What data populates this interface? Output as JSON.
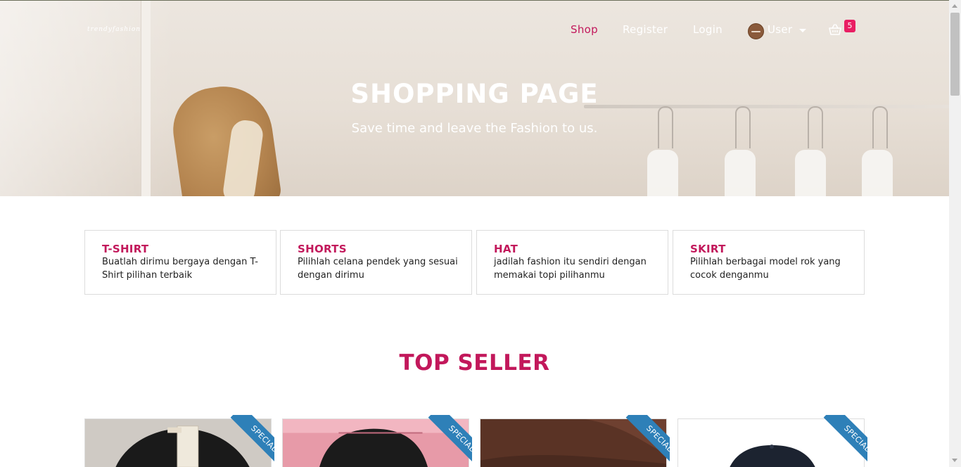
{
  "nav": {
    "logo": "trendyfashion",
    "links": [
      {
        "label": "Shop",
        "active": true
      },
      {
        "label": "Register",
        "active": false
      },
      {
        "label": "Login",
        "active": false
      }
    ],
    "user_label": "User",
    "cart_count": "5"
  },
  "hero": {
    "title": "SHOPPING PAGE",
    "subtitle": "Save time and leave the Fashion to us."
  },
  "categories": [
    {
      "title": "T-SHIRT",
      "desc": "Buatlah dirimu bergaya dengan T-Shirt pilihan terbaik"
    },
    {
      "title": "SHORTS",
      "desc": "Pilihlah celana pendek yang sesuai dengan dirimu"
    },
    {
      "title": "HAT",
      "desc": "jadilah fashion itu sendiri dengan memakai topi pilihanmu"
    },
    {
      "title": "SKIRT",
      "desc": "Pilihlah berbagai model rok yang cocok denganmu"
    }
  ],
  "top_seller": {
    "title": "TOP SELLER",
    "ribbon_label": "SPECIAL",
    "products": [
      {
        "image": "black-tshirt-photo"
      },
      {
        "image": "black-shorts-photo"
      },
      {
        "image": "brown-hat-photo"
      },
      {
        "image": "navy-cap-photo"
      }
    ]
  },
  "colors": {
    "accent": "#c2185b",
    "badge": "#e91e63",
    "ribbon": "#2e80b8"
  }
}
